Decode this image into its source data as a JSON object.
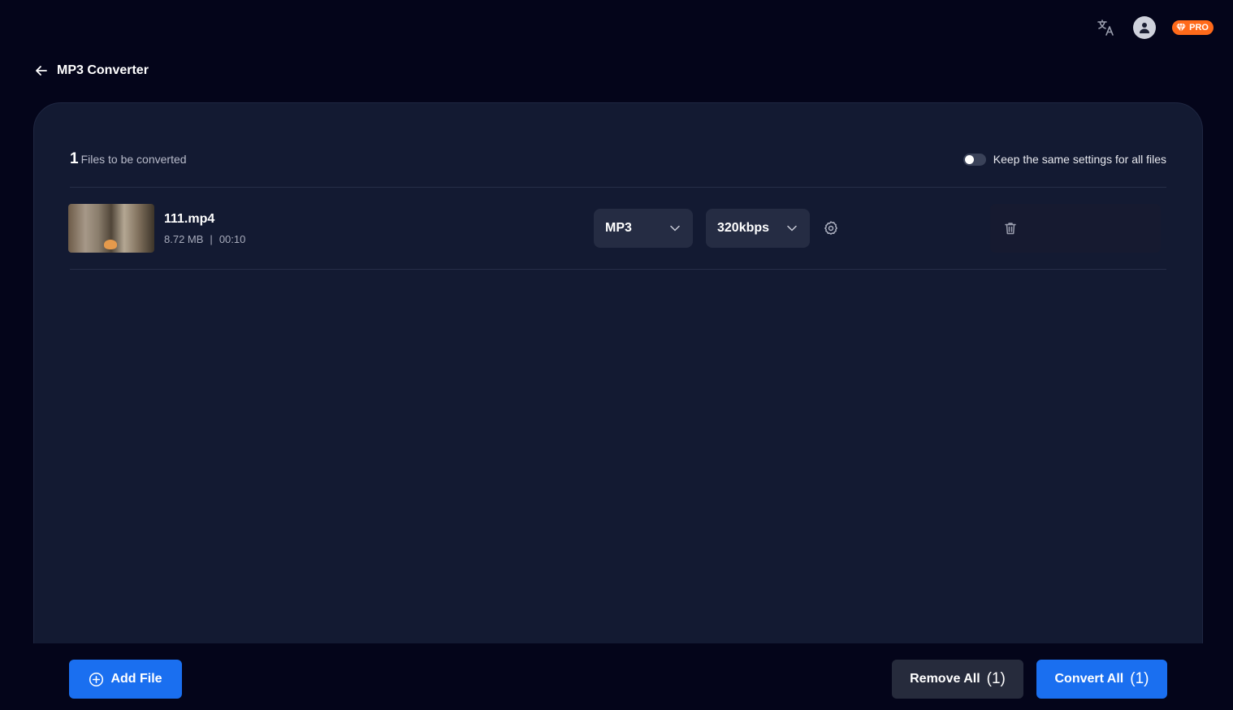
{
  "app": {
    "title": "MP3 Converter",
    "pro_label": "PRO"
  },
  "files_header": {
    "count": "1",
    "label": "Files to be converted",
    "keep_settings_label": "Keep the same settings for all files"
  },
  "files": [
    {
      "name": "111.mp4",
      "size": "8.72 MB",
      "separator": "|",
      "duration": "00:10",
      "format": "MP3",
      "bitrate": "320kbps"
    }
  ],
  "footer": {
    "add_file_label": "Add File",
    "remove_all_label": "Remove All",
    "remove_all_count": "(1)",
    "convert_all_label": "Convert All",
    "convert_all_count": "(1)"
  },
  "icons": {
    "translate": "translate-icon",
    "account": "user-icon",
    "pro": "diamond-icon",
    "back": "arrow-left-icon",
    "chevron": "chevron-down-icon",
    "settings": "gear-icon",
    "delete": "trash-icon",
    "add": "plus-circle-icon"
  },
  "colors": {
    "background": "#04051a",
    "panel": "#131a32",
    "accent": "#1a6ff0",
    "pro": "#ff6a1a"
  }
}
